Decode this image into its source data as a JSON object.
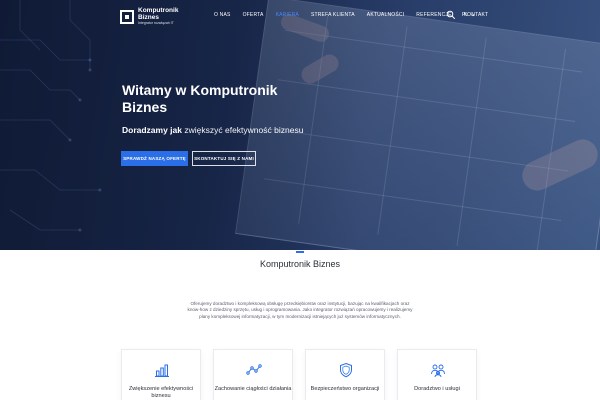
{
  "brand": {
    "name_line1": "Komputronik",
    "name_line2": "Biznes",
    "tagline": "Integrator rozwiązań IT"
  },
  "nav": {
    "items": [
      "O NAS",
      "OFERTA",
      "KARIERA",
      "STREFA KLIENTA",
      "AKTUALNOŚCI",
      "REFERENCJE",
      "KONTAKT"
    ],
    "active_index": 2,
    "language": "PL"
  },
  "hero": {
    "title": "Witamy w Komputronik Biznes",
    "subtitle_bold": "Doradzamy jak",
    "subtitle_rest": "zwiększyć efektywność biznesu",
    "primary_button": "SPRAWDŹ NASZĄ OFERTĘ",
    "secondary_button": "SKONTAKTUJ SIĘ Z NAMI"
  },
  "about": {
    "title": "Komputronik Biznes",
    "text": "Oferujemy doradztwo i kompleksową obsługę przedsiębiorstw oraz instytucji, bazując na kwalifikacjach oraz know-how z dziedziny sprzętu, usług i oprogramowania. Jako integrator rozwiązań opracowujemy i realizujemy plany kompleksowej informatyzacji, w tym modernizacji istniejących już systemów informatycznych."
  },
  "cards": [
    {
      "label": "Zwiększenie efektywności biznesu",
      "icon": "bar-chart-icon"
    },
    {
      "label": "Zachowanie ciągłości działania",
      "icon": "line-nodes-icon"
    },
    {
      "label": "Bezpieczeństwo organizacji",
      "icon": "shield-icon"
    },
    {
      "label": "Doradztwo i usługi",
      "icon": "team-icon"
    }
  ],
  "colors": {
    "accent": "#2a6ee8",
    "nav_active": "#4a86ff",
    "hero_dark": "#14203d"
  }
}
